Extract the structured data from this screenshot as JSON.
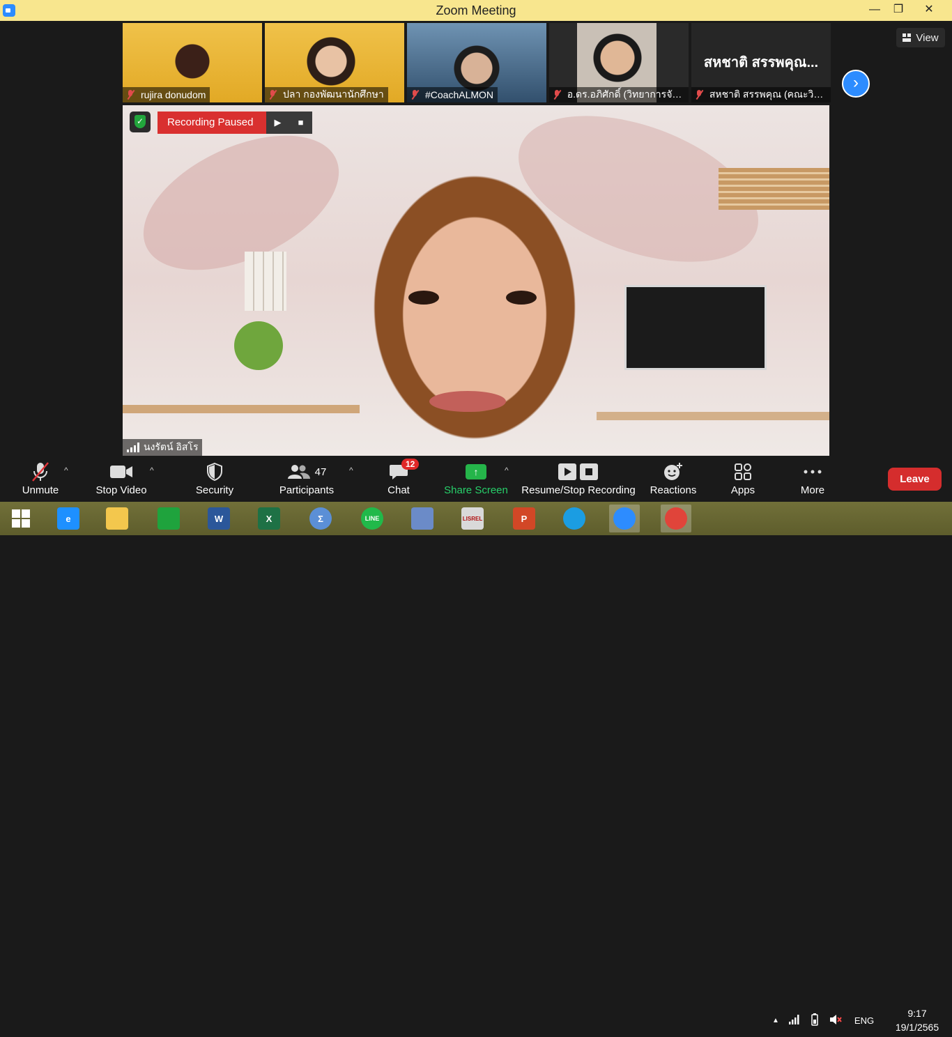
{
  "window": {
    "title": "Zoom Meeting",
    "minimize_glyph": "—",
    "maximize_glyph": "❐",
    "close_glyph": "✕"
  },
  "thumbnails": [
    {
      "name": "rujira donudom",
      "muted": true,
      "bg": "#e9b830"
    },
    {
      "name": "ปลา กองพัฒนานักศึกษา",
      "muted": true,
      "bg": "#e6b22b"
    },
    {
      "name": "#CoachALMON",
      "muted": true,
      "bg": "#4a6d8f"
    },
    {
      "name": "อ.ดร.อภิศักดิ์ (วิทยาการจัด...",
      "muted": true,
      "bg": "#3a3a3a"
    },
    {
      "name": "สหชาติ สรรพคุณ (คณะวิท...",
      "display_name": "สหชาติ สรรพคุณ...",
      "muted": true,
      "bg": "#262626"
    }
  ],
  "view_button": {
    "label": "View",
    "icon": "grid-icon"
  },
  "next_button": {
    "icon": "chevron-right-icon",
    "glyph": "›"
  },
  "recording": {
    "status": "Recording Paused",
    "resume_glyph": "▶",
    "stop_glyph": "■"
  },
  "active_speaker": {
    "name": "นงรัตน์ อิสโร"
  },
  "toolbar": {
    "unmute": "Unmute",
    "stop_video": "Stop Video",
    "security": "Security",
    "participants": "Participants",
    "participants_count": "47",
    "chat": "Chat",
    "chat_badge": "12",
    "share_screen": "Share Screen",
    "resume_stop_recording": "Resume/Stop Recording",
    "reactions": "Reactions",
    "apps": "Apps",
    "more": "More",
    "leave": "Leave",
    "caret_glyph": "^"
  },
  "taskbar": {
    "apps": [
      {
        "name": "internet-explorer",
        "glyph": "e",
        "color": "#1e90ff"
      },
      {
        "name": "file-explorer",
        "glyph": "",
        "color": "#f3c74d"
      },
      {
        "name": "store",
        "glyph": "",
        "color": "#1fa33d"
      },
      {
        "name": "word",
        "glyph": "W",
        "color": "#2b579a"
      },
      {
        "name": "excel",
        "glyph": "X",
        "color": "#1e7145"
      },
      {
        "name": "math",
        "glyph": "Σ",
        "color": "#5b8fd6"
      },
      {
        "name": "line",
        "glyph": "LINE",
        "color": "#21b94a"
      },
      {
        "name": "paint",
        "glyph": "",
        "color": "#6b8bc8"
      },
      {
        "name": "lisrel",
        "glyph": "LISREL",
        "color": "#d9d9d9"
      },
      {
        "name": "powerpoint",
        "glyph": "P",
        "color": "#d24726"
      },
      {
        "name": "edge",
        "glyph": "",
        "color": "#1b9de2"
      },
      {
        "name": "zoom",
        "glyph": "",
        "color": "#2d8cff"
      },
      {
        "name": "chrome",
        "glyph": "",
        "color": "#e0443a"
      }
    ],
    "language": "ENG",
    "time": "9:17",
    "date": "19/1/2565"
  }
}
